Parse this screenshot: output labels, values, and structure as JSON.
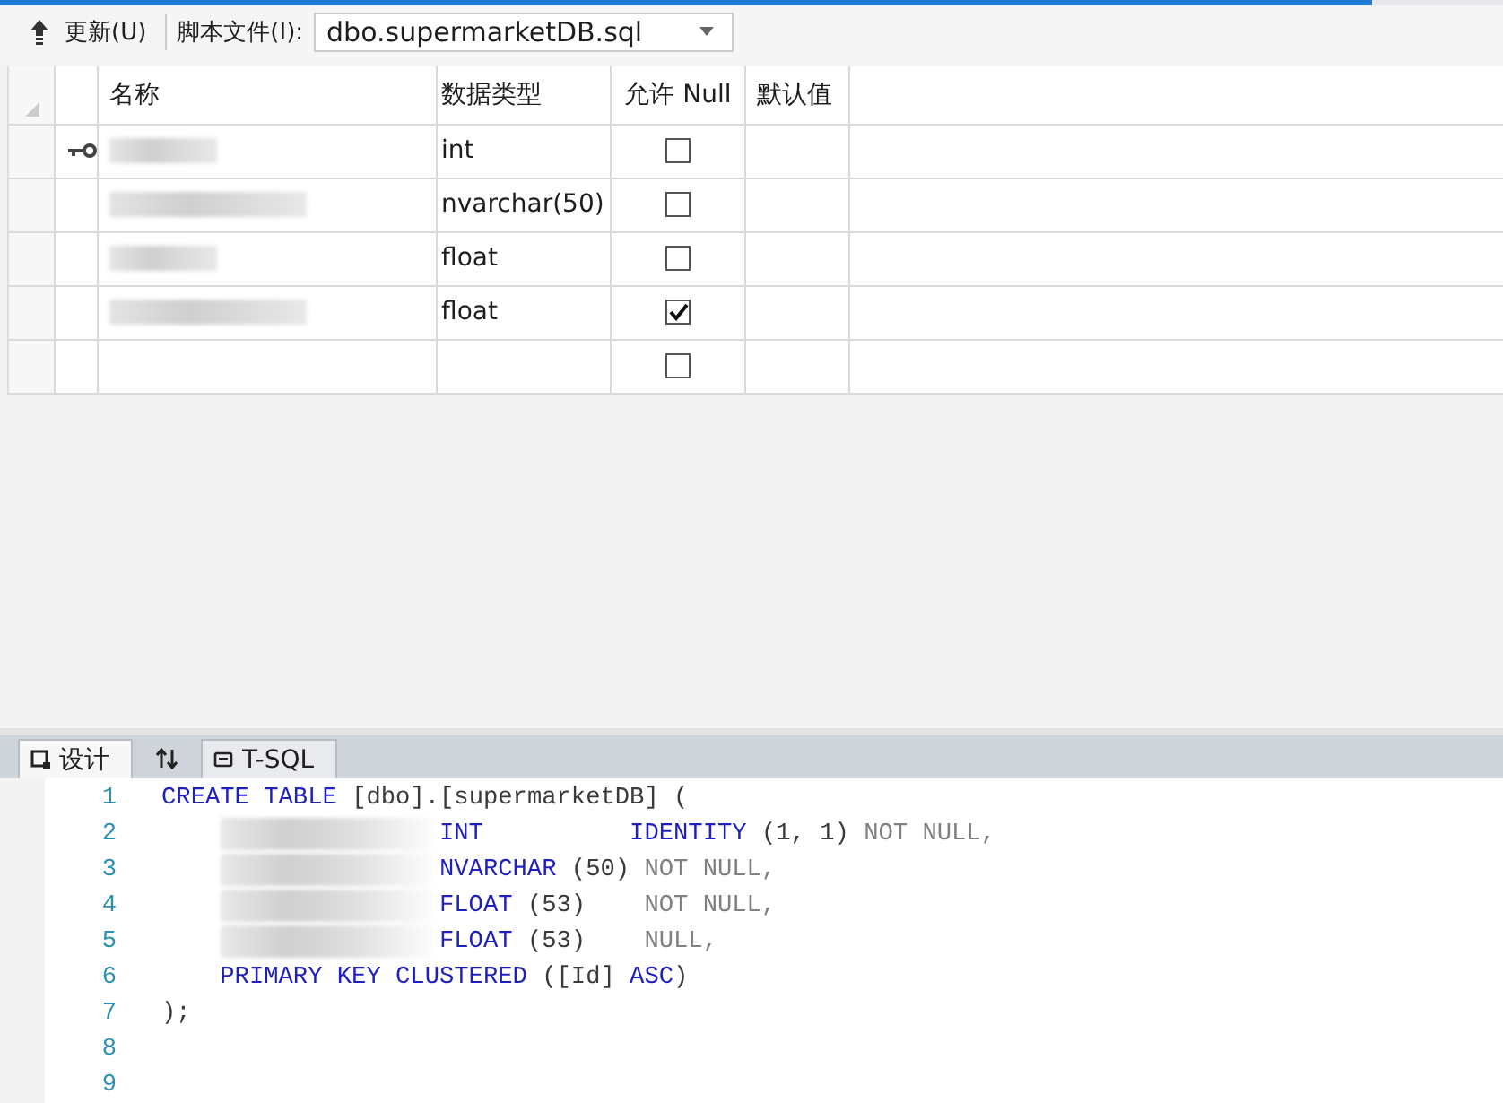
{
  "toolbar": {
    "update_label": "更新(U)",
    "script_label": "脚本文件(I):",
    "script_file": "dbo.supermarketDB.sql"
  },
  "grid": {
    "columns": [
      "名称",
      "数据类型",
      "允许 Null",
      "默认值"
    ],
    "rows": [
      {
        "primary_key": true,
        "name_blurred": true,
        "type": "int",
        "allow_null": false
      },
      {
        "primary_key": false,
        "name_blurred": true,
        "type": "nvarchar(50)",
        "allow_null": false
      },
      {
        "primary_key": false,
        "name_blurred": true,
        "type": "float",
        "allow_null": false
      },
      {
        "primary_key": false,
        "name_blurred": true,
        "type": "float",
        "allow_null": true
      },
      {
        "primary_key": false,
        "name_blurred": false,
        "type": "",
        "allow_null": false
      }
    ]
  },
  "tabs": [
    {
      "kind": "design",
      "label": "设计",
      "selected": true
    },
    {
      "kind": "swap"
    },
    {
      "kind": "tsql",
      "label": "T-SQL",
      "selected": false
    }
  ],
  "code_lines": [
    {
      "number": "1",
      "tokens": [
        {
          "kind": "kw",
          "text": "CREATE TABLE"
        },
        {
          "kind": "txt",
          "text": " [dbo].[supermarketDB] ("
        }
      ]
    },
    {
      "number": "2",
      "tokens": [
        {
          "kind": "indent"
        },
        {
          "kind": "blur"
        },
        {
          "kind": "kw",
          "text": "INT          "
        },
        {
          "kind": "kw",
          "text": "IDENTITY"
        },
        {
          "kind": "txt",
          "text": " (1, 1) "
        },
        {
          "kind": "dim",
          "text": "NOT NULL,"
        }
      ]
    },
    {
      "number": "3",
      "tokens": [
        {
          "kind": "indent"
        },
        {
          "kind": "blur"
        },
        {
          "kind": "kw",
          "text": "NVARCHAR"
        },
        {
          "kind": "txt",
          "text": " (50) "
        },
        {
          "kind": "dim",
          "text": "NOT NULL,"
        }
      ]
    },
    {
      "number": "4",
      "tokens": [
        {
          "kind": "indent"
        },
        {
          "kind": "blur"
        },
        {
          "kind": "kw",
          "text": "FLOAT"
        },
        {
          "kind": "txt",
          "text": " (53)    "
        },
        {
          "kind": "dim",
          "text": "NOT NULL,"
        }
      ]
    },
    {
      "number": "5",
      "tokens": [
        {
          "kind": "indent"
        },
        {
          "kind": "blur"
        },
        {
          "kind": "kw",
          "text": "FLOAT"
        },
        {
          "kind": "txt",
          "text": " (53)    "
        },
        {
          "kind": "dim",
          "text": "NULL,"
        }
      ]
    },
    {
      "number": "6",
      "tokens": [
        {
          "kind": "indent"
        },
        {
          "kind": "kw",
          "text": "PRIMARY KEY CLUSTERED"
        },
        {
          "kind": "txt",
          "text": " ([Id] "
        },
        {
          "kind": "kw",
          "text": "ASC"
        },
        {
          "kind": "txt",
          "text": ")"
        }
      ]
    },
    {
      "number": "7",
      "tokens": [
        {
          "kind": "txt",
          "text": ");"
        }
      ]
    },
    {
      "number": "8"
    },
    {
      "number": "9"
    }
  ]
}
